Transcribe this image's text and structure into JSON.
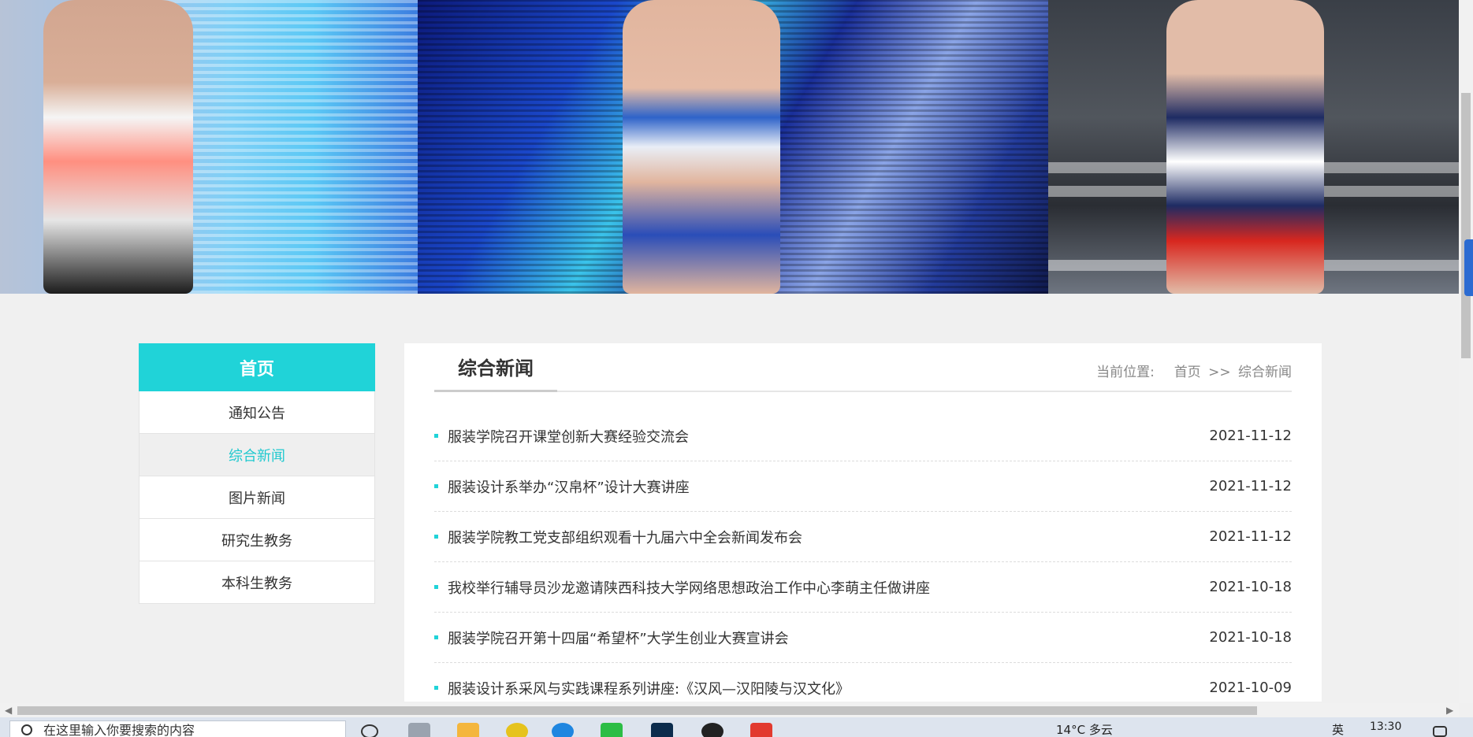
{
  "sidebar": {
    "head": "首页",
    "items": [
      {
        "label": "通知公告",
        "active": false
      },
      {
        "label": "综合新闻",
        "active": true
      },
      {
        "label": "图片新闻",
        "active": false
      },
      {
        "label": "研究生教务",
        "active": false
      },
      {
        "label": "本科生教务",
        "active": false
      }
    ]
  },
  "content": {
    "title": "综合新闻",
    "crumb": {
      "prefix": "当前位置:",
      "home": "首页",
      "sep": ">>",
      "current": "综合新闻"
    },
    "news": [
      {
        "title": "服装学院召开课堂创新大赛经验交流会",
        "date": "2021-11-12"
      },
      {
        "title": "服装设计系举办“汉帛杯”设计大赛讲座",
        "date": "2021-11-12"
      },
      {
        "title": "服装学院教工党支部组织观看十九届六中全会新闻发布会",
        "date": "2021-11-12"
      },
      {
        "title": "我校举行辅导员沙龙邀请陕西科技大学网络思想政治工作中心李萌主任做讲座",
        "date": "2021-10-18"
      },
      {
        "title": "服装学院召开第十四届“希望杯”大学生创业大赛宣讲会",
        "date": "2021-10-18"
      },
      {
        "title": "服装设计系采风与实践课程系列讲座:《汉风—汉阳陵与汉文化》",
        "date": "2021-10-09"
      }
    ]
  },
  "taskbar": {
    "search_placeholder": "在这里输入你要搜索的内容",
    "weather": "14°C 多云",
    "lang": "英",
    "time": "13:30"
  },
  "colors": {
    "accent": "#20d3d8",
    "page_bg": "#f0f0f0"
  }
}
